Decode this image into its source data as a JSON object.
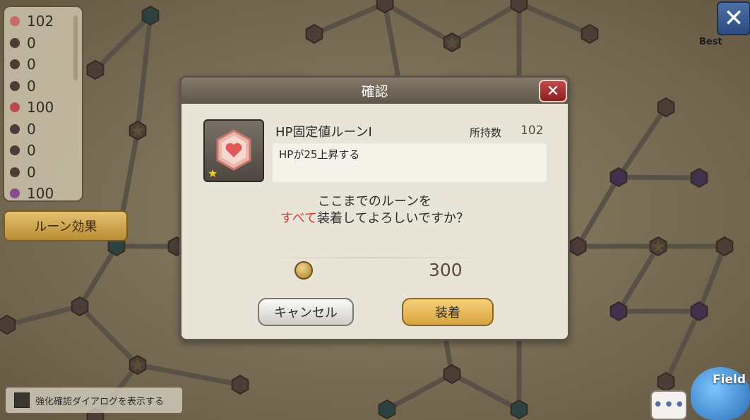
{
  "map": {
    "edge_color": "#6d6459",
    "node_color": "#5b4945",
    "star_color": "#6d6240"
  },
  "rune_list": {
    "items": [
      {
        "count": "102",
        "color": "#c86a6a"
      },
      {
        "count": "0",
        "color": "#4b3d37"
      },
      {
        "count": "0",
        "color": "#4b3d37"
      },
      {
        "count": "0",
        "color": "#4b3d37"
      },
      {
        "count": "100",
        "color": "#b84a55"
      },
      {
        "count": "0",
        "color": "#4b3d37"
      },
      {
        "count": "0",
        "color": "#4b3d37"
      },
      {
        "count": "0",
        "color": "#4b3d37"
      },
      {
        "count": "100",
        "color": "#8a4c8c"
      }
    ]
  },
  "rune_effect_button": {
    "label": "ルーン効果"
  },
  "top_right": {
    "close_icon": "close-icon",
    "best_label": "Best"
  },
  "confirm_toggle": {
    "label": "強化確認ダイアログを表示する",
    "checked": false
  },
  "chat_button": {
    "icon": "chat-bubble-icon",
    "glyph": "•••"
  },
  "field_button": {
    "label": "Field"
  },
  "dialog": {
    "title": "確認",
    "close_glyph": "✕",
    "rune": {
      "name": "HP固定値ルーンⅠ",
      "owned_label": "所持数",
      "owned_count": "102",
      "description": "HPが25上昇する",
      "star": "★",
      "icon": "heart-hexagon-icon"
    },
    "question_line1": "ここまでのルーンを",
    "question_highlight": "すべて",
    "question_line2_rest": "装着してよろしいですか？",
    "cost": "300",
    "coin_icon": "coin-icon",
    "cancel_label": "キャンセル",
    "equip_label": "装着",
    "accent_color": "#d23f32"
  }
}
